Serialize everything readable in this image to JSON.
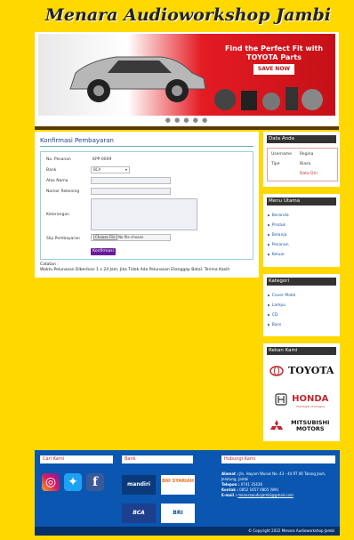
{
  "site_title": "Menara Audioworkshop Jambi",
  "banner": {
    "headline": "Find the Perfect Fit with",
    "brand": "TOYOTA Parts",
    "cta": "SAVE NOW",
    "dots": "● ● ● ● ●"
  },
  "confirm": {
    "heading": "Konfirmasi Pembayaran",
    "fields": {
      "order_no_label": "No. Pesanan",
      "order_no_value": "KPP-0009",
      "bank_label": "Bank",
      "bank_value": "BCA",
      "account_name_label": "Atas Nama",
      "account_number_label": "Nomor Rekening",
      "note_label": "Keterangan",
      "receipt_label": "Slip Pembayaran",
      "file_button": "Choose File",
      "file_status": "No file chosen"
    },
    "submit": "Konfirmasi",
    "note_title": "Catatan :",
    "note_text": "Waktu Pelunasan Diberikan 1 x 24 Jam, Jika Tidak Ada Pelunasan Dianggap Batal. Terima Kasih"
  },
  "sidebar": {
    "account": {
      "heading": "Data Anda",
      "username_label": "Username",
      "username_value": "Regina",
      "type_label": "Tipe",
      "type_value": "Biasa",
      "edit_link": "Data Diri"
    },
    "menu": {
      "heading": "Menu Utama",
      "items": [
        "Beranda",
        "Produk",
        "Belanja",
        "Pesanan",
        "Keluar"
      ]
    },
    "categories": {
      "heading": "Kategori",
      "items": [
        "Cover Mobil",
        "Lampu",
        "CD",
        "Bass"
      ]
    },
    "partners": {
      "heading": "Rekan Kami",
      "items": [
        "TOYOTA",
        "HONDA",
        "MITSUBISHI MOTORS"
      ],
      "honda_tagline": "The Power of Dreams"
    }
  },
  "footer": {
    "find_us": "Cari Kami",
    "bank_heading": "Bank",
    "contact_heading": "Hubungi Kami",
    "banks": [
      "mandiri",
      "BNI SYARIAH",
      "BCA",
      "BRI"
    ],
    "address_label": "Alamat :",
    "address_value": "Jln. Hayam Wuruk No. 43 - 44 RT 06 Talang Jauh, Jelutung, Jambi",
    "phone_label": "Telepon :",
    "phone_value": "0741 35428",
    "contact_label": "Kontak :",
    "contact_value": "0852 1657 0805 (WA)",
    "email_label": "E-mail :",
    "email_value": "menaraaudiojambi@gmail.com",
    "copyright": "© Copyright 2022 Menara Audioworkshop Jambi"
  }
}
